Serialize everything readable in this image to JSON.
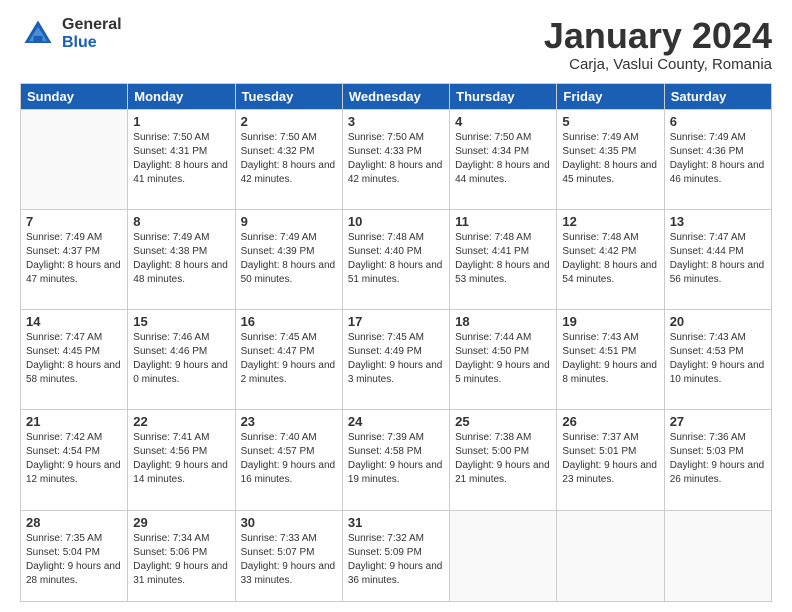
{
  "logo": {
    "general": "General",
    "blue": "Blue"
  },
  "title": "January 2024",
  "subtitle": "Carja, Vaslui County, Romania",
  "days_header": [
    "Sunday",
    "Monday",
    "Tuesday",
    "Wednesday",
    "Thursday",
    "Friday",
    "Saturday"
  ],
  "weeks": [
    [
      {
        "day": "",
        "sunrise": "",
        "sunset": "",
        "daylight": ""
      },
      {
        "day": "1",
        "sunrise": "Sunrise: 7:50 AM",
        "sunset": "Sunset: 4:31 PM",
        "daylight": "Daylight: 8 hours and 41 minutes."
      },
      {
        "day": "2",
        "sunrise": "Sunrise: 7:50 AM",
        "sunset": "Sunset: 4:32 PM",
        "daylight": "Daylight: 8 hours and 42 minutes."
      },
      {
        "day": "3",
        "sunrise": "Sunrise: 7:50 AM",
        "sunset": "Sunset: 4:33 PM",
        "daylight": "Daylight: 8 hours and 42 minutes."
      },
      {
        "day": "4",
        "sunrise": "Sunrise: 7:50 AM",
        "sunset": "Sunset: 4:34 PM",
        "daylight": "Daylight: 8 hours and 44 minutes."
      },
      {
        "day": "5",
        "sunrise": "Sunrise: 7:49 AM",
        "sunset": "Sunset: 4:35 PM",
        "daylight": "Daylight: 8 hours and 45 minutes."
      },
      {
        "day": "6",
        "sunrise": "Sunrise: 7:49 AM",
        "sunset": "Sunset: 4:36 PM",
        "daylight": "Daylight: 8 hours and 46 minutes."
      }
    ],
    [
      {
        "day": "7",
        "sunrise": "Sunrise: 7:49 AM",
        "sunset": "Sunset: 4:37 PM",
        "daylight": "Daylight: 8 hours and 47 minutes."
      },
      {
        "day": "8",
        "sunrise": "Sunrise: 7:49 AM",
        "sunset": "Sunset: 4:38 PM",
        "daylight": "Daylight: 8 hours and 48 minutes."
      },
      {
        "day": "9",
        "sunrise": "Sunrise: 7:49 AM",
        "sunset": "Sunset: 4:39 PM",
        "daylight": "Daylight: 8 hours and 50 minutes."
      },
      {
        "day": "10",
        "sunrise": "Sunrise: 7:48 AM",
        "sunset": "Sunset: 4:40 PM",
        "daylight": "Daylight: 8 hours and 51 minutes."
      },
      {
        "day": "11",
        "sunrise": "Sunrise: 7:48 AM",
        "sunset": "Sunset: 4:41 PM",
        "daylight": "Daylight: 8 hours and 53 minutes."
      },
      {
        "day": "12",
        "sunrise": "Sunrise: 7:48 AM",
        "sunset": "Sunset: 4:42 PM",
        "daylight": "Daylight: 8 hours and 54 minutes."
      },
      {
        "day": "13",
        "sunrise": "Sunrise: 7:47 AM",
        "sunset": "Sunset: 4:44 PM",
        "daylight": "Daylight: 8 hours and 56 minutes."
      }
    ],
    [
      {
        "day": "14",
        "sunrise": "Sunrise: 7:47 AM",
        "sunset": "Sunset: 4:45 PM",
        "daylight": "Daylight: 8 hours and 58 minutes."
      },
      {
        "day": "15",
        "sunrise": "Sunrise: 7:46 AM",
        "sunset": "Sunset: 4:46 PM",
        "daylight": "Daylight: 9 hours and 0 minutes."
      },
      {
        "day": "16",
        "sunrise": "Sunrise: 7:45 AM",
        "sunset": "Sunset: 4:47 PM",
        "daylight": "Daylight: 9 hours and 2 minutes."
      },
      {
        "day": "17",
        "sunrise": "Sunrise: 7:45 AM",
        "sunset": "Sunset: 4:49 PM",
        "daylight": "Daylight: 9 hours and 3 minutes."
      },
      {
        "day": "18",
        "sunrise": "Sunrise: 7:44 AM",
        "sunset": "Sunset: 4:50 PM",
        "daylight": "Daylight: 9 hours and 5 minutes."
      },
      {
        "day": "19",
        "sunrise": "Sunrise: 7:43 AM",
        "sunset": "Sunset: 4:51 PM",
        "daylight": "Daylight: 9 hours and 8 minutes."
      },
      {
        "day": "20",
        "sunrise": "Sunrise: 7:43 AM",
        "sunset": "Sunset: 4:53 PM",
        "daylight": "Daylight: 9 hours and 10 minutes."
      }
    ],
    [
      {
        "day": "21",
        "sunrise": "Sunrise: 7:42 AM",
        "sunset": "Sunset: 4:54 PM",
        "daylight": "Daylight: 9 hours and 12 minutes."
      },
      {
        "day": "22",
        "sunrise": "Sunrise: 7:41 AM",
        "sunset": "Sunset: 4:56 PM",
        "daylight": "Daylight: 9 hours and 14 minutes."
      },
      {
        "day": "23",
        "sunrise": "Sunrise: 7:40 AM",
        "sunset": "Sunset: 4:57 PM",
        "daylight": "Daylight: 9 hours and 16 minutes."
      },
      {
        "day": "24",
        "sunrise": "Sunrise: 7:39 AM",
        "sunset": "Sunset: 4:58 PM",
        "daylight": "Daylight: 9 hours and 19 minutes."
      },
      {
        "day": "25",
        "sunrise": "Sunrise: 7:38 AM",
        "sunset": "Sunset: 5:00 PM",
        "daylight": "Daylight: 9 hours and 21 minutes."
      },
      {
        "day": "26",
        "sunrise": "Sunrise: 7:37 AM",
        "sunset": "Sunset: 5:01 PM",
        "daylight": "Daylight: 9 hours and 23 minutes."
      },
      {
        "day": "27",
        "sunrise": "Sunrise: 7:36 AM",
        "sunset": "Sunset: 5:03 PM",
        "daylight": "Daylight: 9 hours and 26 minutes."
      }
    ],
    [
      {
        "day": "28",
        "sunrise": "Sunrise: 7:35 AM",
        "sunset": "Sunset: 5:04 PM",
        "daylight": "Daylight: 9 hours and 28 minutes."
      },
      {
        "day": "29",
        "sunrise": "Sunrise: 7:34 AM",
        "sunset": "Sunset: 5:06 PM",
        "daylight": "Daylight: 9 hours and 31 minutes."
      },
      {
        "day": "30",
        "sunrise": "Sunrise: 7:33 AM",
        "sunset": "Sunset: 5:07 PM",
        "daylight": "Daylight: 9 hours and 33 minutes."
      },
      {
        "day": "31",
        "sunrise": "Sunrise: 7:32 AM",
        "sunset": "Sunset: 5:09 PM",
        "daylight": "Daylight: 9 hours and 36 minutes."
      },
      {
        "day": "",
        "sunrise": "",
        "sunset": "",
        "daylight": ""
      },
      {
        "day": "",
        "sunrise": "",
        "sunset": "",
        "daylight": ""
      },
      {
        "day": "",
        "sunrise": "",
        "sunset": "",
        "daylight": ""
      }
    ]
  ]
}
